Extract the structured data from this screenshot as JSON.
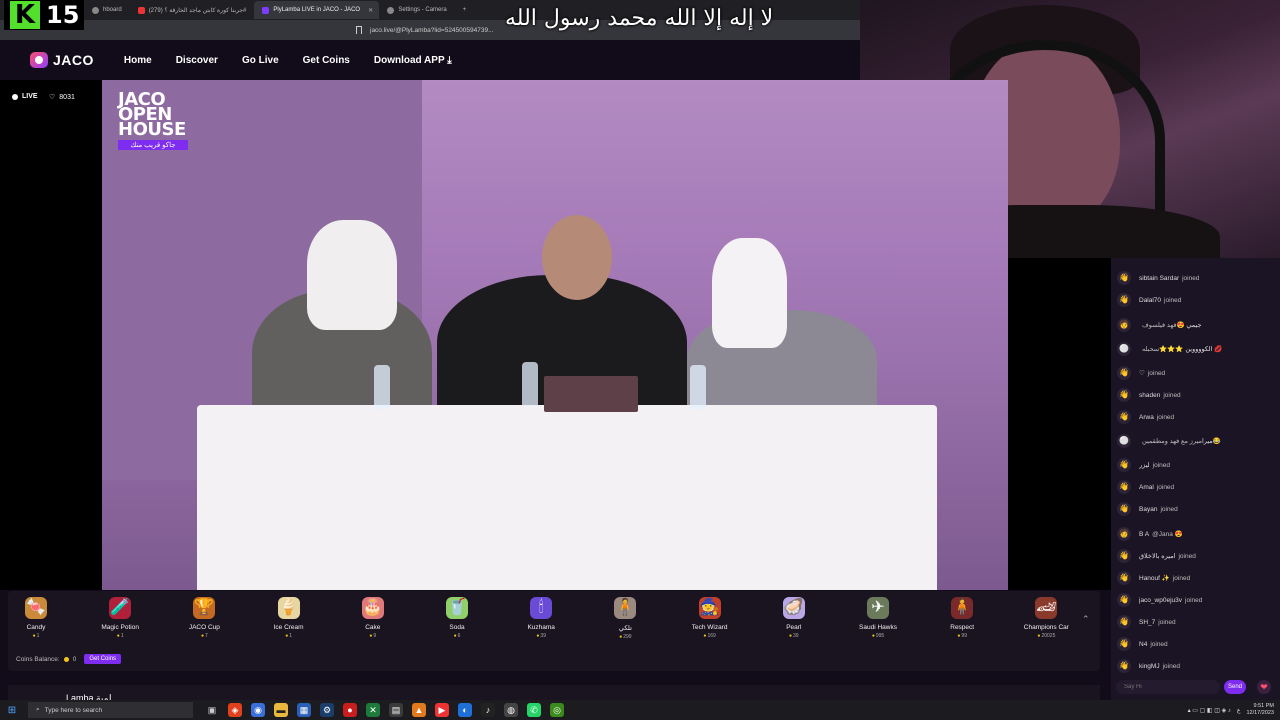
{
  "browser": {
    "tabs": [
      {
        "label": "hboard",
        "icon": "dashboard-icon"
      },
      {
        "label": "(279) جربنا كورة كابتن ماجد الخارقة ؟#",
        "icon": "youtube-icon"
      },
      {
        "label": "PlyLamba LIVE in JACO - JACO",
        "icon": "jaco-icon"
      },
      {
        "label": "Settings - Camera",
        "icon": "settings-icon"
      }
    ],
    "address": "jaco.live/@PlyLamba?lid=524500594739...",
    "overlay_text": "لا إله إلا الله محمد رسول الله"
  },
  "badge": {
    "letter": "K",
    "number": "15"
  },
  "site": {
    "logo": "JACO",
    "nav": [
      "Home",
      "Discover",
      "Go Live",
      "Get Coins",
      "Download APP ⤓"
    ]
  },
  "stream": {
    "live_label": "LIVE",
    "viewer_count": "8031",
    "video_overlay_lines": [
      "JACO",
      "OPEN",
      "HOUSE"
    ],
    "video_overlay_sub": "جاكو قريب منك",
    "streamer_name": "Lamba لمبة"
  },
  "gifts": [
    {
      "name": "Candy",
      "price": "1",
      "emoji": "🍬",
      "color": "#c98b3a"
    },
    {
      "name": "Magic Potion",
      "price": "1",
      "emoji": "🧪",
      "color": "#b0203a"
    },
    {
      "name": "JACO Cup",
      "price": "7",
      "emoji": "🏆",
      "color": "#c46a22"
    },
    {
      "name": "Ice Cream",
      "price": "1",
      "emoji": "🍦",
      "color": "#e8d6a0"
    },
    {
      "name": "Cake",
      "price": "9",
      "emoji": "🎂",
      "color": "#e07a7a"
    },
    {
      "name": "Soda",
      "price": "6",
      "emoji": "🥤",
      "color": "#8fd06a"
    },
    {
      "name": "Kuzhama",
      "price": "39",
      "emoji": "🕯",
      "color": "#6a4bd6"
    },
    {
      "name": "تلكي",
      "price": "299",
      "emoji": "🧍",
      "color": "#9a8a80"
    },
    {
      "name": "Tech Wizard",
      "price": "169",
      "emoji": "🧙",
      "color": "#c2402a"
    },
    {
      "name": "Pearl",
      "price": "39",
      "emoji": "🦪",
      "color": "#b9a7e6"
    },
    {
      "name": "Saudi Hawks",
      "price": "995",
      "emoji": "✈",
      "color": "#6a7a5a"
    },
    {
      "name": "Respect",
      "price": "99",
      "emoji": "🧍",
      "color": "#7a2a2a"
    },
    {
      "name": "Champions Car",
      "price": "20025",
      "emoji": "🏎",
      "color": "#8a3a2a"
    }
  ],
  "balance": {
    "label": "Coins Balance:",
    "value": "0",
    "button": "Get Coins"
  },
  "chat": {
    "messages": [
      {
        "user": "sibtain Sardar",
        "text": "joined",
        "avatar": "👋"
      },
      {
        "user": "Dalal70",
        "text": "joined",
        "avatar": "👋"
      },
      {
        "user": "جيمي 😍",
        "text": "فهد فيلسوف",
        "avatar": "🧑"
      },
      {
        "user": "الكووووين ⭐⭐⭐",
        "text": "سحبله 💋",
        "avatar": "⚪"
      },
      {
        "user": "♡",
        "text": "joined",
        "avatar": "👋"
      },
      {
        "user": "shaden",
        "text": "joined",
        "avatar": "👋"
      },
      {
        "user": "Arwa",
        "text": "joined",
        "avatar": "👋"
      },
      {
        "user": "ميرا",
        "text": "ميرز مع فهد ومطقمين😂",
        "avatar": "⚪"
      },
      {
        "user": "ليزر",
        "text": "joined",
        "avatar": "👋"
      },
      {
        "user": "Amal",
        "text": "joined",
        "avatar": "👋"
      },
      {
        "user": "Bayan",
        "text": "joined",
        "avatar": "👋"
      },
      {
        "user": "B A",
        "text": "@Jana 😍",
        "avatar": "🧑"
      },
      {
        "user": "اميره بالاخلاق",
        "text": "joined",
        "avatar": "👋"
      },
      {
        "user": "Hanouf ✨",
        "text": "joined",
        "avatar": "👋"
      },
      {
        "user": "jaco_wp0eju3v",
        "text": "joined",
        "avatar": "👋"
      },
      {
        "user": "SH_7",
        "text": "joined",
        "avatar": "👋"
      },
      {
        "user": "N4",
        "text": "joined",
        "avatar": "👋"
      },
      {
        "user": "kingMJ",
        "text": "joined",
        "avatar": "👋"
      }
    ],
    "input_placeholder": "Say Hi",
    "send_label": "Send"
  },
  "taskbar": {
    "search_placeholder": "Type here to search",
    "time": "9:51 PM",
    "date": "12/17/2023"
  }
}
